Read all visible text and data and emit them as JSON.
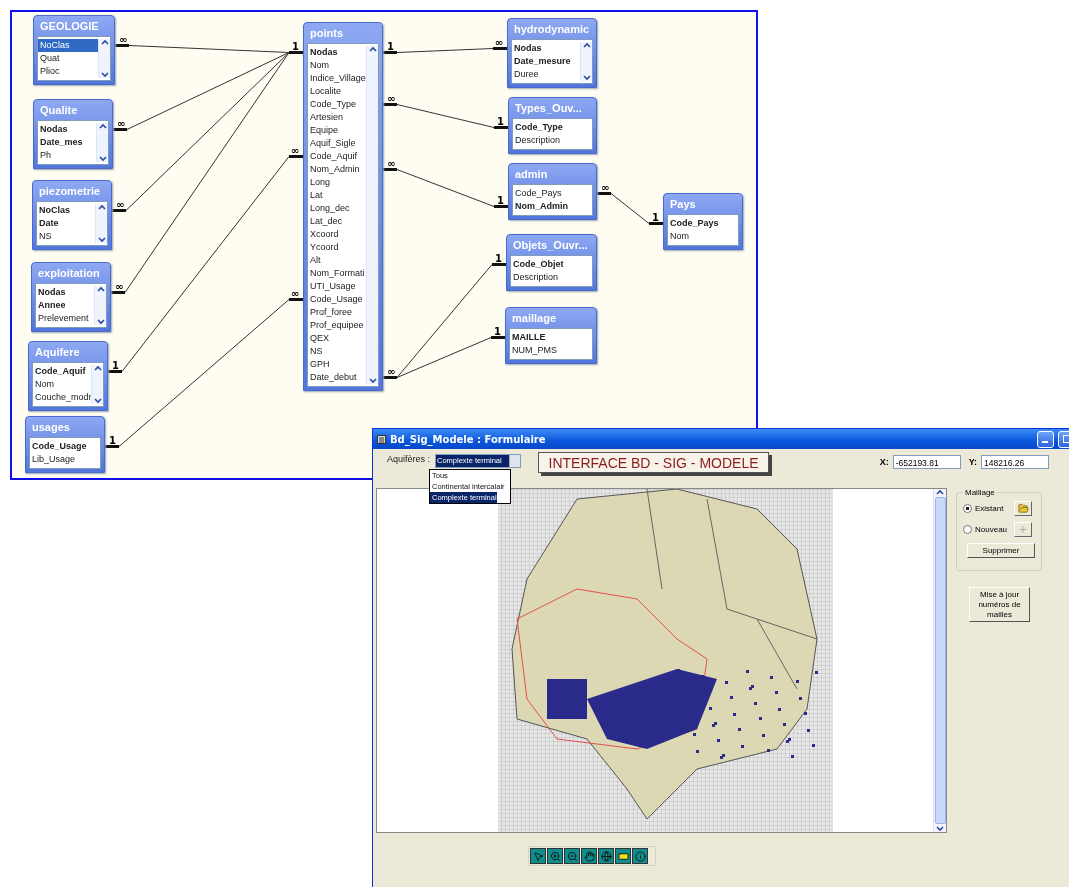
{
  "diagram": {
    "tables": [
      {
        "title": "GEOLOGIE",
        "fields": [
          {
            "name": "NoClas",
            "key": false,
            "selected": true
          },
          {
            "name": "Quat",
            "key": false,
            "selected": false
          },
          {
            "name": "Plioc",
            "key": false,
            "selected": false
          }
        ]
      },
      {
        "title": "Qualite",
        "fields": [
          {
            "name": "Nodas",
            "key": true,
            "selected": false
          },
          {
            "name": "Date_mes",
            "key": true,
            "selected": false
          },
          {
            "name": "Ph",
            "key": false,
            "selected": false
          }
        ]
      },
      {
        "title": "piezometrie",
        "fields": [
          {
            "name": "NoClas",
            "key": true,
            "selected": false
          },
          {
            "name": "Date",
            "key": true,
            "selected": false
          },
          {
            "name": "NS",
            "key": false,
            "selected": false
          }
        ]
      },
      {
        "title": "exploitation",
        "fields": [
          {
            "name": "Nodas",
            "key": true,
            "selected": false
          },
          {
            "name": "Annee",
            "key": true,
            "selected": false
          },
          {
            "name": "Prelevement",
            "key": false,
            "selected": false
          }
        ]
      },
      {
        "title": "Aquifere",
        "fields": [
          {
            "name": "Code_Aquif",
            "key": true,
            "selected": false
          },
          {
            "name": "Nom",
            "key": false,
            "selected": false
          },
          {
            "name": "Couche_modr",
            "key": false,
            "selected": false
          }
        ]
      },
      {
        "title": "usages",
        "fields": [
          {
            "name": "Code_Usage",
            "key": true,
            "selected": false
          },
          {
            "name": "Lib_Usage",
            "key": false,
            "selected": false
          }
        ]
      },
      {
        "title": "points",
        "fields": [
          {
            "name": "Nodas",
            "key": true,
            "selected": false
          },
          {
            "name": "Nom",
            "key": false,
            "selected": false
          },
          {
            "name": "Indice_Village",
            "key": false,
            "selected": false
          },
          {
            "name": "Localite",
            "key": false,
            "selected": false
          },
          {
            "name": "Code_Type",
            "key": false,
            "selected": false
          },
          {
            "name": "Artesien",
            "key": false,
            "selected": false
          },
          {
            "name": "Equipe",
            "key": false,
            "selected": false
          },
          {
            "name": "Aquif_Sigle",
            "key": false,
            "selected": false
          },
          {
            "name": "Code_Aquif",
            "key": false,
            "selected": false
          },
          {
            "name": "Nom_Admin",
            "key": false,
            "selected": false
          },
          {
            "name": "Long",
            "key": false,
            "selected": false
          },
          {
            "name": "Lat",
            "key": false,
            "selected": false
          },
          {
            "name": "Long_dec",
            "key": false,
            "selected": false
          },
          {
            "name": "Lat_dec",
            "key": false,
            "selected": false
          },
          {
            "name": "Xcoord",
            "key": false,
            "selected": false
          },
          {
            "name": "Ycoord",
            "key": false,
            "selected": false
          },
          {
            "name": "Alt",
            "key": false,
            "selected": false
          },
          {
            "name": "Nom_Formati",
            "key": false,
            "selected": false
          },
          {
            "name": "UTI_Usage",
            "key": false,
            "selected": false
          },
          {
            "name": "Code_Usage",
            "key": false,
            "selected": false
          },
          {
            "name": "Prof_foree",
            "key": false,
            "selected": false
          },
          {
            "name": "Prof_equipee",
            "key": false,
            "selected": false
          },
          {
            "name": "QEX",
            "key": false,
            "selected": false
          },
          {
            "name": "NS",
            "key": false,
            "selected": false
          },
          {
            "name": "GPH",
            "key": false,
            "selected": false
          },
          {
            "name": "Date_debut",
            "key": false,
            "selected": false
          }
        ]
      },
      {
        "title": "hydrodynamic",
        "fields": [
          {
            "name": "Nodas",
            "key": true,
            "selected": false
          },
          {
            "name": "Date_mesure",
            "key": true,
            "selected": false
          },
          {
            "name": "Duree",
            "key": false,
            "selected": false
          }
        ]
      },
      {
        "title": "Types_Ouv...",
        "fields": [
          {
            "name": "Code_Type",
            "key": true,
            "selected": false
          },
          {
            "name": "Description",
            "key": false,
            "selected": false
          }
        ]
      },
      {
        "title": "admin",
        "fields": [
          {
            "name": "Code_Pays",
            "key": false,
            "selected": false
          },
          {
            "name": "Nom_Admin",
            "key": true,
            "selected": false
          }
        ]
      },
      {
        "title": "Pays",
        "fields": [
          {
            "name": "Code_Pays",
            "key": true,
            "selected": false
          },
          {
            "name": "Nom",
            "key": false,
            "selected": false
          }
        ]
      },
      {
        "title": "Objets_Ouvr...",
        "fields": [
          {
            "name": "Code_Objet",
            "key": true,
            "selected": false
          },
          {
            "name": "Description",
            "key": false,
            "selected": false
          }
        ]
      },
      {
        "title": "maillage",
        "fields": [
          {
            "name": "MAILLE",
            "key": true,
            "selected": false
          },
          {
            "name": "NUM_PMS",
            "key": false,
            "selected": false
          }
        ]
      }
    ],
    "relationships": [
      {
        "from_label": "∞",
        "to_label": "1"
      },
      {
        "from_label": "∞"
      },
      {
        "from_label": "∞"
      },
      {
        "from_label": "∞"
      },
      {
        "from_label": "1",
        "to_label": "∞"
      },
      {
        "from_label": "1",
        "to_label": "∞"
      },
      {
        "from_label": "1",
        "to_label": "∞"
      },
      {
        "from_label": "∞",
        "to_label": "1"
      },
      {
        "from_label": "∞",
        "to_label": "1"
      },
      {
        "from_label": "∞",
        "to_label": "1"
      },
      {
        "to_label": "1"
      },
      {
        "from_label": "∞",
        "to_label": "1"
      }
    ]
  },
  "form": {
    "title": "Bd_Sig_Modele : Formulaire",
    "aquifer_label": "Aquifères :",
    "aquifer_value": "Complexte terminal",
    "aquifer_options": [
      {
        "label": "Tous",
        "selected": false
      },
      {
        "label": "Continental intercalair",
        "selected": false
      },
      {
        "label": "Complexte terminal",
        "selected": true
      }
    ],
    "banner": "INTERFACE BD - SIG - MODELE",
    "x_label": "X:",
    "x_value": "-652193.81",
    "y_label": "Y:",
    "y_value": "148216.26",
    "maillage": {
      "title": "Maillage",
      "options": [
        {
          "label": "Existant",
          "selected": true
        },
        {
          "label": "Nouveau",
          "selected": false
        }
      ],
      "new_button": {
        "label": "+",
        "disabled": true
      },
      "delete_button": "Supprimer"
    },
    "update_button": "Mise à jour numéros de mailles"
  }
}
